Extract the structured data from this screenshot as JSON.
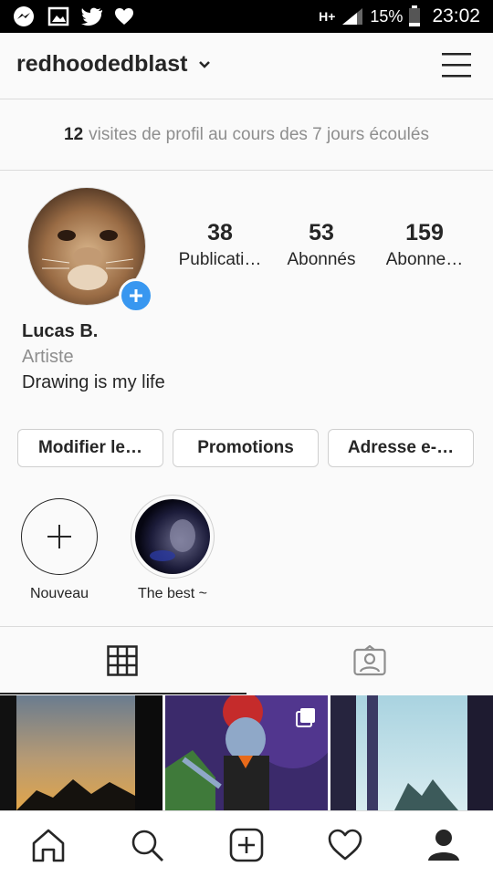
{
  "statusbar": {
    "network": "H+",
    "battery": "15%",
    "time": "23:02",
    "icons": [
      "messenger-icon",
      "gallery-icon",
      "twitter-icon",
      "heart-icon",
      "signal-icon",
      "battery-icon"
    ]
  },
  "header": {
    "username": "redhoodedblast",
    "icons": [
      "chevron-down-icon",
      "hamburger-menu-icon"
    ]
  },
  "visits": {
    "count": "12",
    "text": "visites de profil au cours des 7 jours écoulés"
  },
  "stats": [
    {
      "value": "38",
      "label": "Publicati…"
    },
    {
      "value": "53",
      "label": "Abonnés"
    },
    {
      "value": "159",
      "label": "Abonne…"
    }
  ],
  "bio": {
    "name": "Lucas B.",
    "category": "Artiste",
    "text": "Drawing is my life"
  },
  "buttons": {
    "edit": "Modifier le…",
    "promotions": "Promotions",
    "email": "Adresse e-…"
  },
  "highlights": [
    {
      "label": "Nouveau"
    },
    {
      "label": "The best ~"
    }
  ],
  "tabs": [
    "grid-icon",
    "tagged-photos-icon"
  ],
  "bottom_nav": [
    "home-icon",
    "search-icon",
    "new-post-icon",
    "activity-heart-icon",
    "profile-icon"
  ],
  "colors": {
    "accent": "#3897f0",
    "text": "#262626",
    "muted": "#8e8e8e",
    "border": "#dbdbdb"
  }
}
